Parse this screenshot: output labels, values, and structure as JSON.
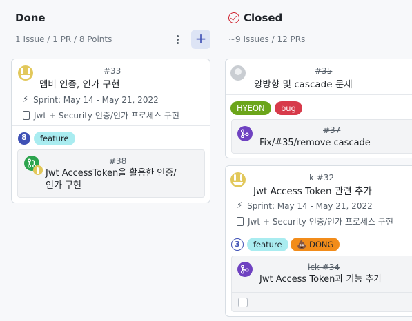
{
  "done": {
    "title": "Done",
    "subtitle": "1 Issue / 1 PR / 8 Points",
    "add_label": "+",
    "card": {
      "number": "#33",
      "title": "멤버 인증, 인가 구현",
      "sprint": "Sprint: May 14 - May 21, 2022",
      "form": "Jwt + Security 인증/인가 프로세스 구현",
      "points": "8",
      "labels": [
        {
          "text": "feature",
          "bg": "#a9ecf0",
          "fg": "#1f2328"
        }
      ],
      "pr": {
        "number": "#38",
        "title_line1": "Jwt AccessToken을 활용한 인증/",
        "title_line2": "인가 구현"
      }
    }
  },
  "closed": {
    "title": "Closed",
    "subtitle": "~9 Issues / 12 PRs",
    "card1": {
      "number": "#35",
      "title": "양방향 및 cascade 문제",
      "labels": [
        {
          "text": "HYEON",
          "bg": "#6ba51a",
          "fg": "#ffffff"
        },
        {
          "text": "bug",
          "bg": "#d73a4a",
          "fg": "#ffffff"
        }
      ],
      "pr": {
        "number": "#37",
        "title": "Fix/#35/remove cascade"
      }
    },
    "card2": {
      "number_prefix": "k ",
      "number": "#32",
      "title": "Jwt Access Token 관련 추가",
      "sprint": "Sprint: May 14 - May 21, 2022",
      "form": "Jwt + Security 인증/인가 프로세스 구현",
      "points": "3",
      "labels": [
        {
          "text": "feature",
          "bg": "#a9ecf0",
          "fg": "#1f2328"
        },
        {
          "text": "💩 DONG",
          "bg": "#f28c1a",
          "fg": "#1f2328"
        }
      ],
      "pr": {
        "number_prefix": "ick ",
        "number": "#34",
        "title": "Jwt Access Token과 기능 추가"
      }
    }
  },
  "colors": {
    "accent": "#3f51b5",
    "merged": "#6f42c1",
    "open_pr": "#2da44e",
    "closed": "#cf222e"
  }
}
